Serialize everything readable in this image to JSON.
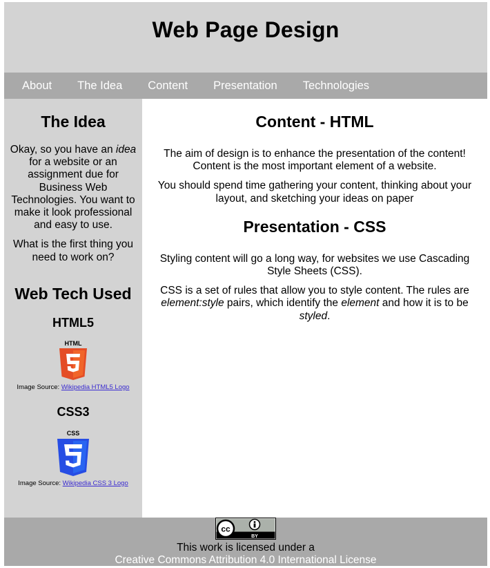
{
  "header": {
    "title": "Web Page Design"
  },
  "nav": {
    "items": [
      "About",
      "The Idea",
      "Content",
      "Presentation",
      "Technologies"
    ]
  },
  "sidebar": {
    "idea_title": "The Idea",
    "idea_p1_a": "Okay, so you have an ",
    "idea_p1_em": "idea",
    "idea_p1_b": " for a website or an assignment due for Business Web Technologies. You want to make it look professional and easy to use.",
    "idea_p2": "What is the first thing you need to work on?",
    "tech_title": "Web Tech Used",
    "html5": {
      "heading": "HTML5",
      "logo_text": "HTML",
      "logo_digit": "5",
      "source_label": "Image Source: ",
      "source_link": "Wikipedia HTML5 Logo"
    },
    "css3": {
      "heading": "CSS3",
      "logo_text": "CSS",
      "logo_digit": "3",
      "source_label": "Image Source: ",
      "source_link": "Wikipedia CSS 3 Logo"
    }
  },
  "main": {
    "content_title": "Content - HTML",
    "content_p1": "The aim of design is to enhance the presentation of the content! Content is the most important element of a website.",
    "content_p2": "You should spend time gathering your content, thinking about your layout, and sketching your ideas on paper",
    "presentation_title": "Presentation - CSS",
    "presentation_p1": "Styling content will go a long way, for websites we use Cascading Style Sheets (CSS).",
    "presentation_p2_a": "CSS is a set of rules that allow you to style content. The rules are ",
    "presentation_p2_em1": "element:style",
    "presentation_p2_b": " pairs, which identify the ",
    "presentation_p2_em2": "element",
    "presentation_p2_c": " and how it is to be ",
    "presentation_p2_em3": "styled",
    "presentation_p2_d": "."
  },
  "footer": {
    "badge_cc": "cc",
    "badge_by": "BY",
    "line1": "This work is licensed under a",
    "line2": "Creative Commons Attribution 4.0 International License"
  },
  "colors": {
    "header_bg": "#d3d3d3",
    "nav_bg": "#a9a9a9",
    "html5_orange": "#e44d26",
    "css3_blue": "#264de4",
    "link": "#3a2bd0"
  }
}
